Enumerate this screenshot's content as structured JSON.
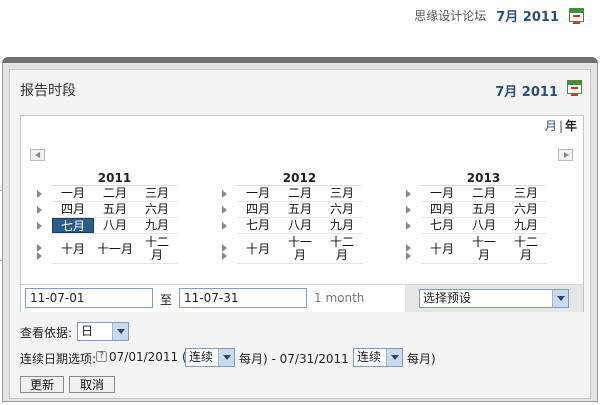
{
  "topbar": {
    "watermark": "思缘设计论坛",
    "date": "7月 2011"
  },
  "dialog": {
    "title": "报告时段",
    "date": "7月 2011",
    "toggle": {
      "month": "月",
      "year": "年",
      "separator": "|"
    },
    "years": [
      {
        "year": "2011",
        "rows": [
          [
            "一月",
            "二月",
            "三月"
          ],
          [
            "四月",
            "五月",
            "六月"
          ],
          [
            "七月",
            "八月",
            "九月"
          ],
          [
            "十月",
            "十一月",
            "十二\n月"
          ]
        ],
        "selected": "七月"
      },
      {
        "year": "2012",
        "rows": [
          [
            "一月",
            "二月",
            "三月"
          ],
          [
            "四月",
            "五月",
            "六月"
          ],
          [
            "七月",
            "八月",
            "九月"
          ],
          [
            "十月",
            "十一\n月",
            "十二\n月"
          ]
        ]
      },
      {
        "year": "2013",
        "rows": [
          [
            "一月",
            "二月",
            "三月"
          ],
          [
            "四月",
            "五月",
            "六月"
          ],
          [
            "七月",
            "八月",
            "九月"
          ],
          [
            "十月",
            "十一\n月",
            "十二\n月"
          ]
        ]
      }
    ],
    "range": {
      "start": "11-07-01",
      "to_label": "至",
      "end": "11-07-31",
      "duration": "1 month",
      "preset": "选择预设"
    },
    "view_by": {
      "label": "查看依据:",
      "value": "日"
    },
    "continuous": {
      "label": "连续日期选项:",
      "start_date": "07/01/2011 (",
      "start_mode": "连续",
      "start_suffix": "每月) - 07/31/2011 (",
      "end_mode": "连续",
      "end_suffix": "每月)"
    },
    "buttons": {
      "update": "更新",
      "cancel": "取消"
    }
  },
  "colors": {
    "accent": "#2b5d8a",
    "link": "#2b4f7a",
    "icon_green": "#4a8a3c"
  }
}
